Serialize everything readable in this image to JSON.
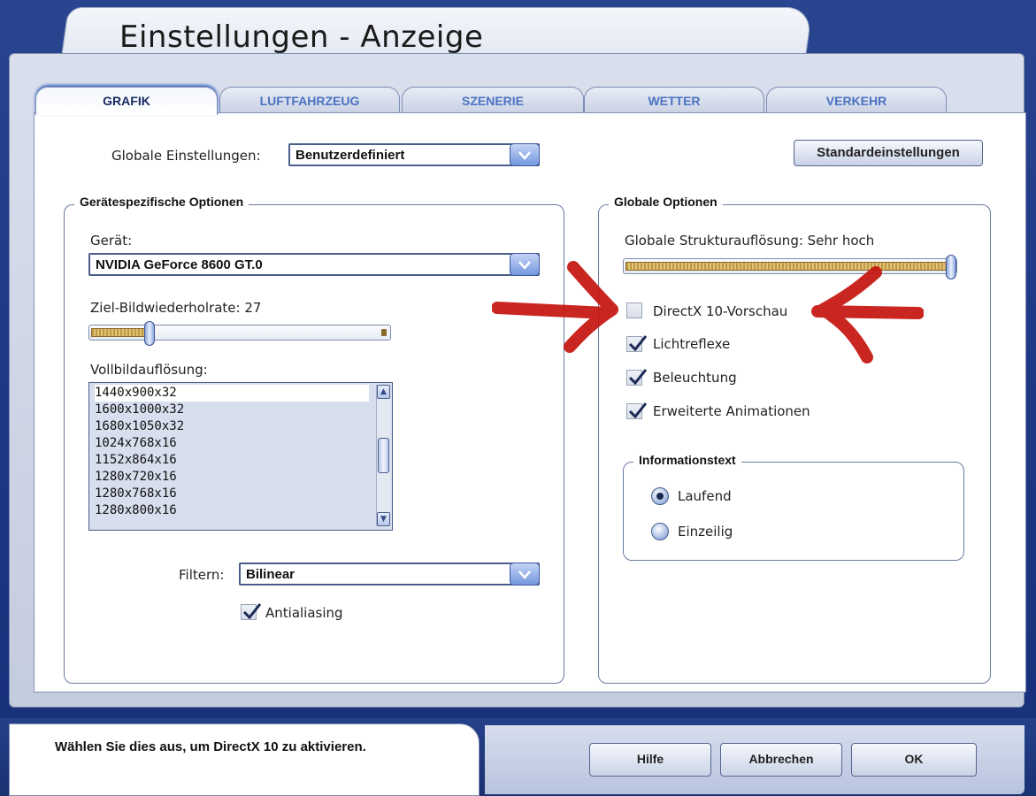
{
  "window": {
    "title": "Einstellungen - Anzeige"
  },
  "tabs": [
    {
      "label": "GRAFIK",
      "active": true
    },
    {
      "label": "LUFTFAHRZEUG",
      "active": false
    },
    {
      "label": "SZENERIE",
      "active": false
    },
    {
      "label": "WETTER",
      "active": false
    },
    {
      "label": "VERKEHR",
      "active": false
    }
  ],
  "top": {
    "global_settings_label": "Globale Einstellungen:",
    "global_settings_value": "Benutzerdefiniert",
    "defaults_button": "Standardeinstellungen"
  },
  "device_group": {
    "title": "Gerätespezifische Optionen",
    "device_label": "Gerät:",
    "device_value": "NVIDIA GeForce 8600 GT.0",
    "framerate_label": "Ziel-Bildwiederholrate: 27",
    "framerate_level": 0.18,
    "resolution_label": "Vollbildauflösung:",
    "resolutions": [
      "1440x900x32",
      "1600x1000x32",
      "1680x1050x32",
      "1024x768x16",
      "1152x864x16",
      "1280x720x16",
      "1280x768x16",
      "1280x800x16"
    ],
    "selected_resolution": "1440x900x32",
    "filter_label": "Filtern:",
    "filter_value": "Bilinear",
    "antialiasing_label": "Antialiasing",
    "antialiasing_checked": true
  },
  "global_group": {
    "title": "Globale Optionen",
    "texture_label": "Globale Strukturauflösung: Sehr hoch",
    "texture_level": 1.0,
    "options": [
      {
        "label": "DirectX 10-Vorschau",
        "checked": false
      },
      {
        "label": "Lichtreflexe",
        "checked": true
      },
      {
        "label": "Beleuchtung",
        "checked": true
      },
      {
        "label": "Erweiterte Animationen",
        "checked": true
      }
    ],
    "info_group": {
      "title": "Informationstext",
      "options": [
        {
          "label": "Laufend",
          "selected": true
        },
        {
          "label": "Einzeilig",
          "selected": false
        }
      ]
    }
  },
  "status": {
    "text": "Wählen Sie dies aus, um DirectX 10 zu aktivieren."
  },
  "buttons": {
    "help": "Hilfe",
    "cancel": "Abbrechen",
    "ok": "OK"
  },
  "colors": {
    "frame_blue": "#1f3a86",
    "annotation_red": "#c4140e",
    "tab_text": "#4b72c2"
  }
}
